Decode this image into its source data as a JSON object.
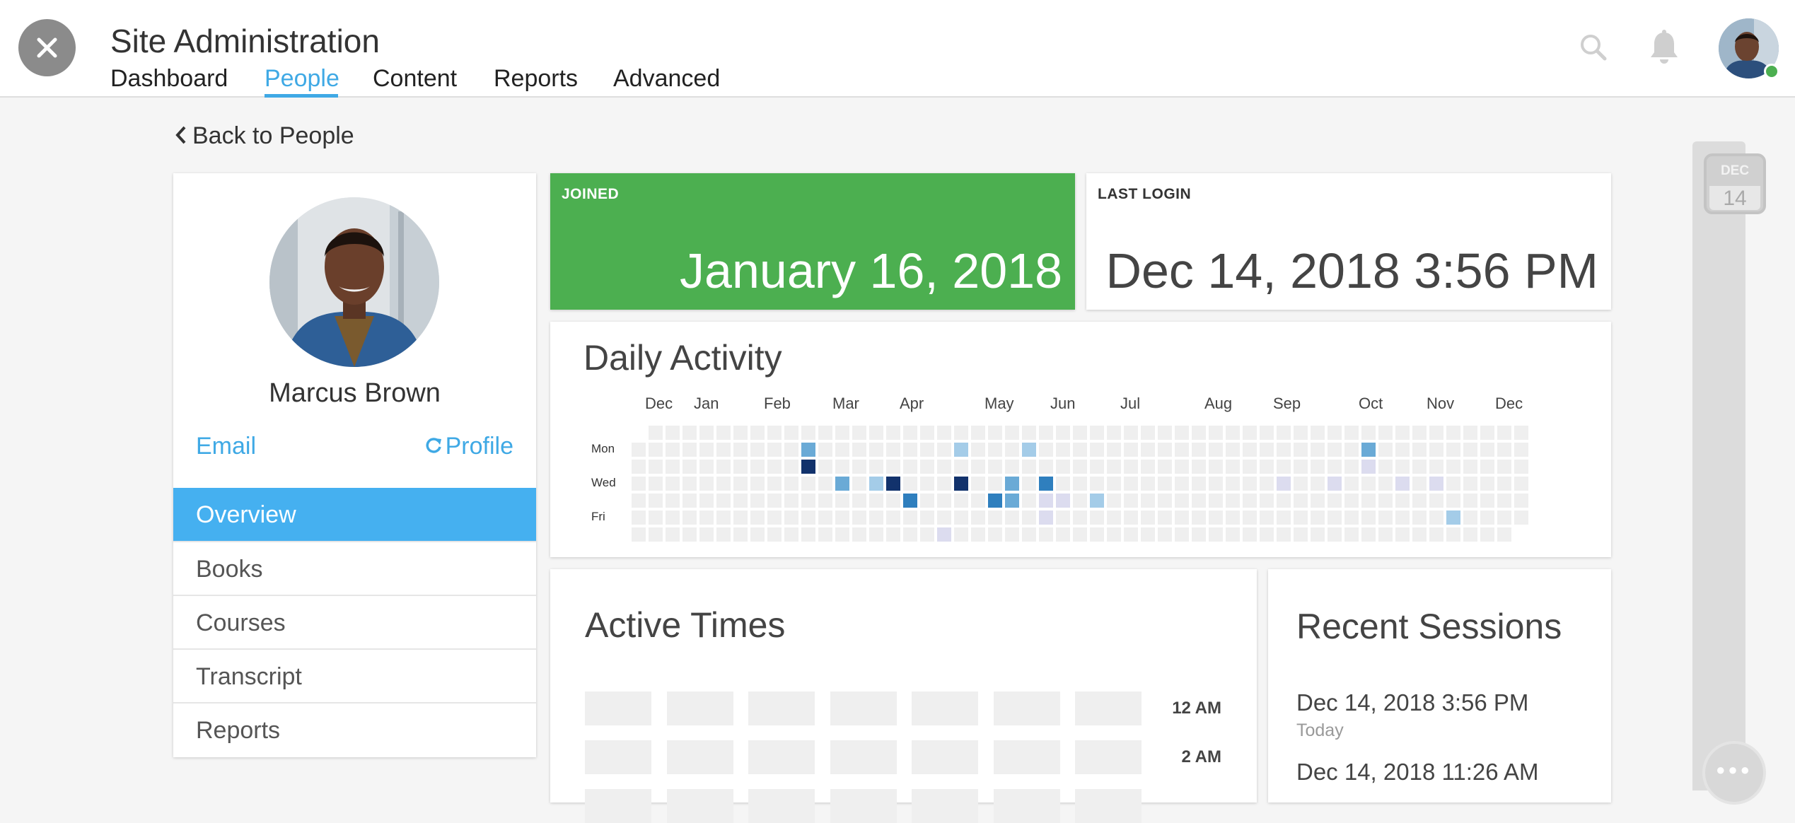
{
  "header": {
    "title": "Site Administration",
    "tabs": [
      "Dashboard",
      "People",
      "Content",
      "Reports",
      "Advanced"
    ],
    "active_tab": "People"
  },
  "back_link": "Back to People",
  "profile": {
    "name": "Marcus Brown",
    "email_link": "Email",
    "profile_link": "Profile",
    "menu": [
      "Overview",
      "Books",
      "Courses",
      "Transcript",
      "Reports"
    ],
    "active_menu": "Overview"
  },
  "joined": {
    "label": "JOINED",
    "value": "January 16, 2018"
  },
  "last_login": {
    "label": "LAST LOGIN",
    "value": "Dec 14, 2018 3:56 PM"
  },
  "daily_activity": {
    "title": "Daily Activity",
    "months": [
      "Dec",
      "Jan",
      "Feb",
      "Mar",
      "Apr",
      "May",
      "Jun",
      "Jul",
      "Aug",
      "Sep",
      "Oct",
      "Nov",
      "Dec"
    ],
    "day_labels": [
      "Mon",
      "Wed",
      "Fri"
    ],
    "weeks": 53,
    "active_days": [
      {
        "week": 10,
        "day": 1,
        "level": 2
      },
      {
        "week": 10,
        "day": 2,
        "level": 4
      },
      {
        "week": 12,
        "day": 3,
        "level": 2
      },
      {
        "week": 14,
        "day": 3,
        "level": 1
      },
      {
        "week": 15,
        "day": 3,
        "level": 4
      },
      {
        "week": 16,
        "day": 4,
        "level": 3
      },
      {
        "week": 19,
        "day": 1,
        "level": 1
      },
      {
        "week": 19,
        "day": 3,
        "level": 4
      },
      {
        "week": 18,
        "day": 6,
        "level": 0
      },
      {
        "week": 21,
        "day": 4,
        "level": 3
      },
      {
        "week": 22,
        "day": 3,
        "level": 2
      },
      {
        "week": 22,
        "day": 4,
        "level": 2
      },
      {
        "week": 23,
        "day": 1,
        "level": 1
      },
      {
        "week": 24,
        "day": 3,
        "level": 3
      },
      {
        "week": 24,
        "day": 4,
        "level": 0
      },
      {
        "week": 24,
        "day": 5,
        "level": 0
      },
      {
        "week": 25,
        "day": 4,
        "level": 0
      },
      {
        "week": 27,
        "day": 4,
        "level": 1
      },
      {
        "week": 38,
        "day": 3,
        "level": 0
      },
      {
        "week": 41,
        "day": 3,
        "level": 0
      },
      {
        "week": 43,
        "day": 1,
        "level": 2
      },
      {
        "week": 43,
        "day": 2,
        "level": 0
      },
      {
        "week": 45,
        "day": 3,
        "level": 0
      },
      {
        "week": 47,
        "day": 3,
        "level": 0
      },
      {
        "week": 48,
        "day": 5,
        "level": 1
      }
    ],
    "colors": [
      "#dcdcef",
      "#a4cce8",
      "#6aaad6",
      "#2f7fbe",
      "#12326c"
    ]
  },
  "active_times": {
    "title": "Active Times",
    "time_labels": [
      "12 AM",
      "2 AM"
    ]
  },
  "recent_sessions": {
    "title": "Recent Sessions",
    "sessions": [
      {
        "date": "Dec 14, 2018 3:56 PM",
        "sub": "Today"
      },
      {
        "date": "Dec 14, 2018 11:26 AM",
        "sub": ""
      }
    ]
  },
  "calendar_chip": {
    "month": "DEC",
    "day": "14"
  },
  "colors": {
    "accent": "#3fa9e5",
    "joined_bg": "#4caf50",
    "menu_active": "#45b0f0"
  },
  "icons": [
    "close-icon",
    "search-icon",
    "bell-icon",
    "chevron-left-icon",
    "refresh-icon",
    "more-icon"
  ]
}
